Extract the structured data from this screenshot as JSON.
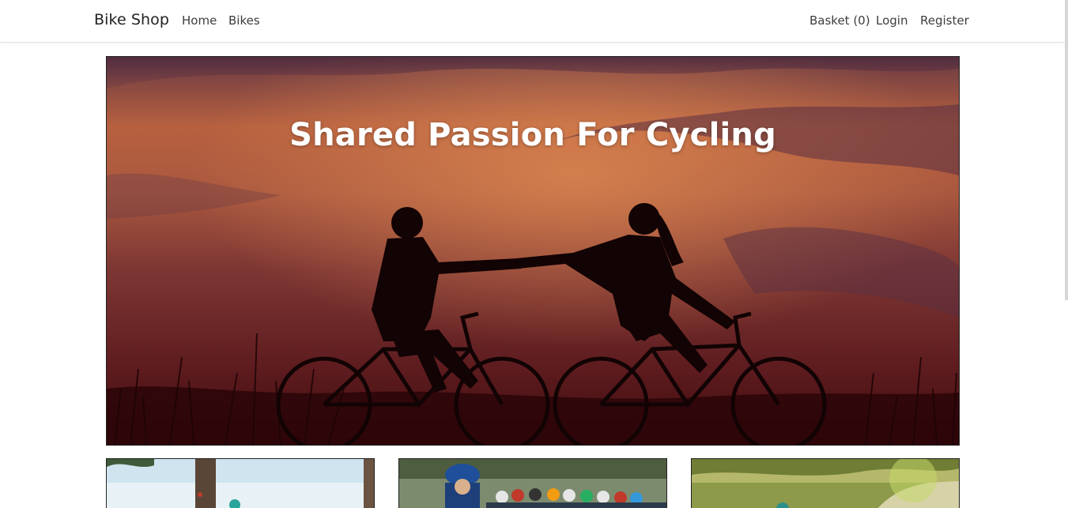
{
  "navbar": {
    "brand": "Bike Shop",
    "links": {
      "home": "Home",
      "bikes": "Bikes",
      "basket": "Basket (0)",
      "login": "Login",
      "register": "Register"
    }
  },
  "hero": {
    "title": "Shared Passion For Cycling",
    "image": "couple-cycling-sunset-silhouette"
  },
  "cards": [
    {
      "image": "bike-by-tree-with-cyclist"
    },
    {
      "image": "road-race-peloton"
    },
    {
      "image": "mountain-bike-trail"
    }
  ],
  "colors": {
    "navbar_bg": "#ffffff",
    "text": "#3d3d3d",
    "hero_sky_top": "#5b3a4e",
    "hero_sky_glow": "#c8704a",
    "hero_ground": "#5a1212"
  }
}
